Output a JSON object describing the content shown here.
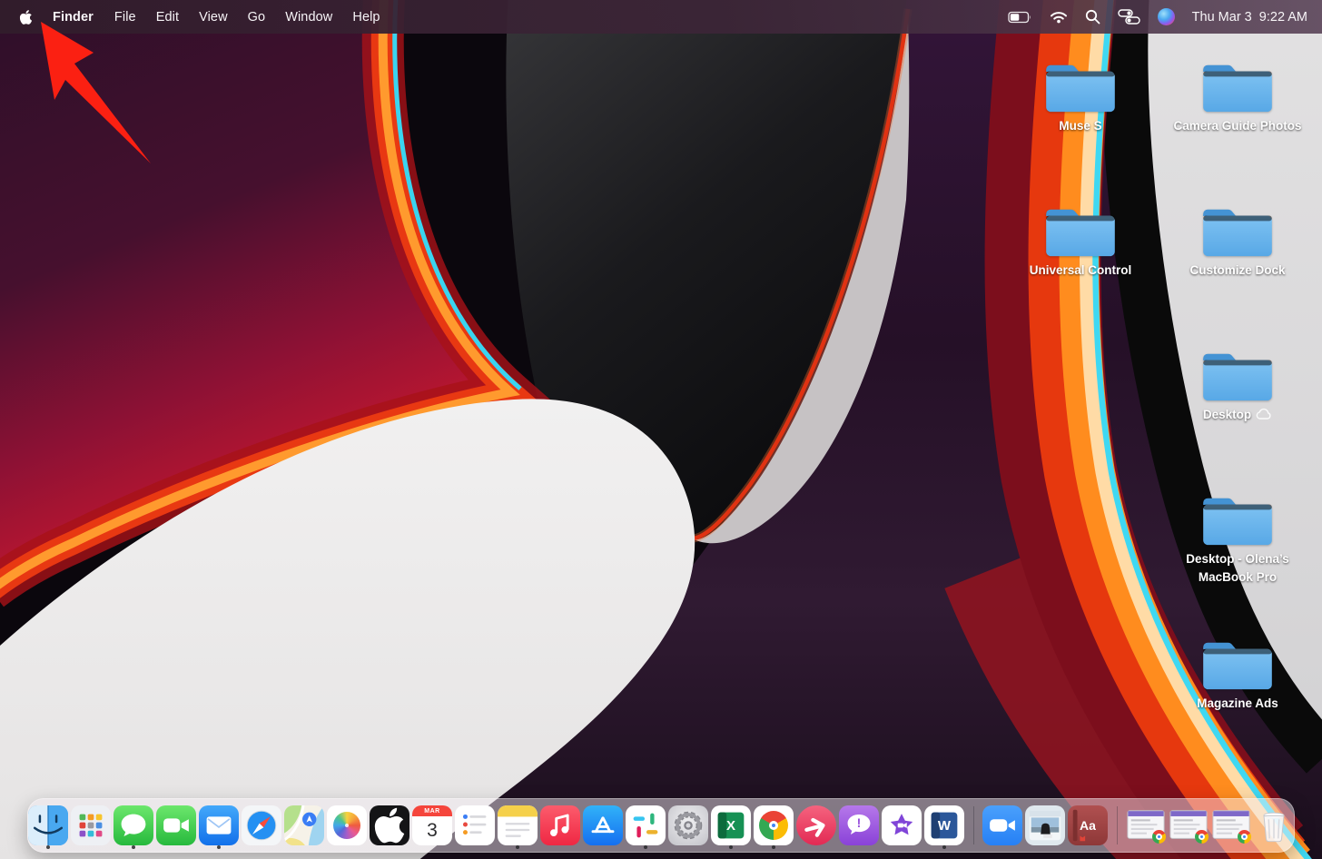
{
  "menu_bar": {
    "menus": [
      {
        "label": "Finder",
        "bold": true
      },
      {
        "label": "File"
      },
      {
        "label": "Edit"
      },
      {
        "label": "View"
      },
      {
        "label": "Go"
      },
      {
        "label": "Window"
      },
      {
        "label": "Help"
      }
    ],
    "status_icons": [
      "battery-icon",
      "wifi-icon",
      "spotlight-search-icon",
      "control-center-icon",
      "siri-icon"
    ],
    "clock": "Thu Mar 3  9:22 AM"
  },
  "desktop": {
    "folders": [
      {
        "name": "Muse S",
        "column": 1,
        "row": 1
      },
      {
        "name": "Camera Guide Photos",
        "column": 2,
        "row": 1
      },
      {
        "name": "Universal Control",
        "column": 1,
        "row": 2
      },
      {
        "name": "Customize Dock",
        "column": 2,
        "row": 2
      },
      {
        "name": "Desktop",
        "column": 2,
        "row": 3,
        "icloud": true
      },
      {
        "name": "Desktop - Olena’s MacBook Pro",
        "column": 2,
        "row": 4
      },
      {
        "name": "Magazine Ads",
        "column": 2,
        "row": 5
      }
    ]
  },
  "annotation": {
    "type": "red-arrow",
    "points_to": "apple-menu",
    "color": "#fb2012"
  },
  "dock": {
    "apps": [
      {
        "id": "finder",
        "label": "Finder",
        "running": true
      },
      {
        "id": "launchpad",
        "label": "Launchpad"
      },
      {
        "id": "messages",
        "label": "Messages",
        "running": true
      },
      {
        "id": "facetime",
        "label": "FaceTime"
      },
      {
        "id": "mail",
        "label": "Mail",
        "running": true
      },
      {
        "id": "safari",
        "label": "Safari"
      },
      {
        "id": "maps",
        "label": "Maps"
      },
      {
        "id": "photos",
        "label": "Photos"
      },
      {
        "id": "appletv",
        "label": "Apple TV",
        "glyph": "tv"
      },
      {
        "id": "calendar",
        "label": "Calendar",
        "month": "MAR",
        "day": "3"
      },
      {
        "id": "reminders",
        "label": "Reminders"
      },
      {
        "id": "notes",
        "label": "Notes",
        "running": true
      },
      {
        "id": "music",
        "label": "Music"
      },
      {
        "id": "appstore",
        "label": "App Store"
      },
      {
        "id": "slack",
        "label": "Slack",
        "running": true
      },
      {
        "id": "syspref",
        "label": "System Preferences"
      },
      {
        "id": "excel",
        "label": "Microsoft Excel",
        "glyph": "X",
        "running": true
      },
      {
        "id": "chrome",
        "label": "Google Chrome",
        "running": true
      },
      {
        "id": "skitch",
        "label": "Skitch"
      },
      {
        "id": "alertapp",
        "label": "Chat Alert App",
        "glyph": "!"
      },
      {
        "id": "imovie",
        "label": "iMovie"
      },
      {
        "id": "word",
        "label": "Microsoft Word",
        "glyph": "W",
        "running": true
      },
      {
        "id": "divider"
      },
      {
        "id": "zoom",
        "label": "Zoom"
      },
      {
        "id": "previewapp",
        "label": "Preview"
      },
      {
        "id": "dictionary",
        "label": "Dictionary",
        "glyph": "Aa"
      },
      {
        "id": "divider"
      },
      {
        "id": "window",
        "label": "Minimized Chrome Window"
      },
      {
        "id": "window",
        "label": "Minimized Chrome Window"
      },
      {
        "id": "window",
        "label": "Minimized Chrome Window"
      },
      {
        "id": "trash",
        "label": "Trash"
      }
    ]
  },
  "colors": {
    "annotation_arrow": "#fb2012",
    "folder_blue": "#5aa9e8",
    "menubar_tint": "#3c2637"
  }
}
